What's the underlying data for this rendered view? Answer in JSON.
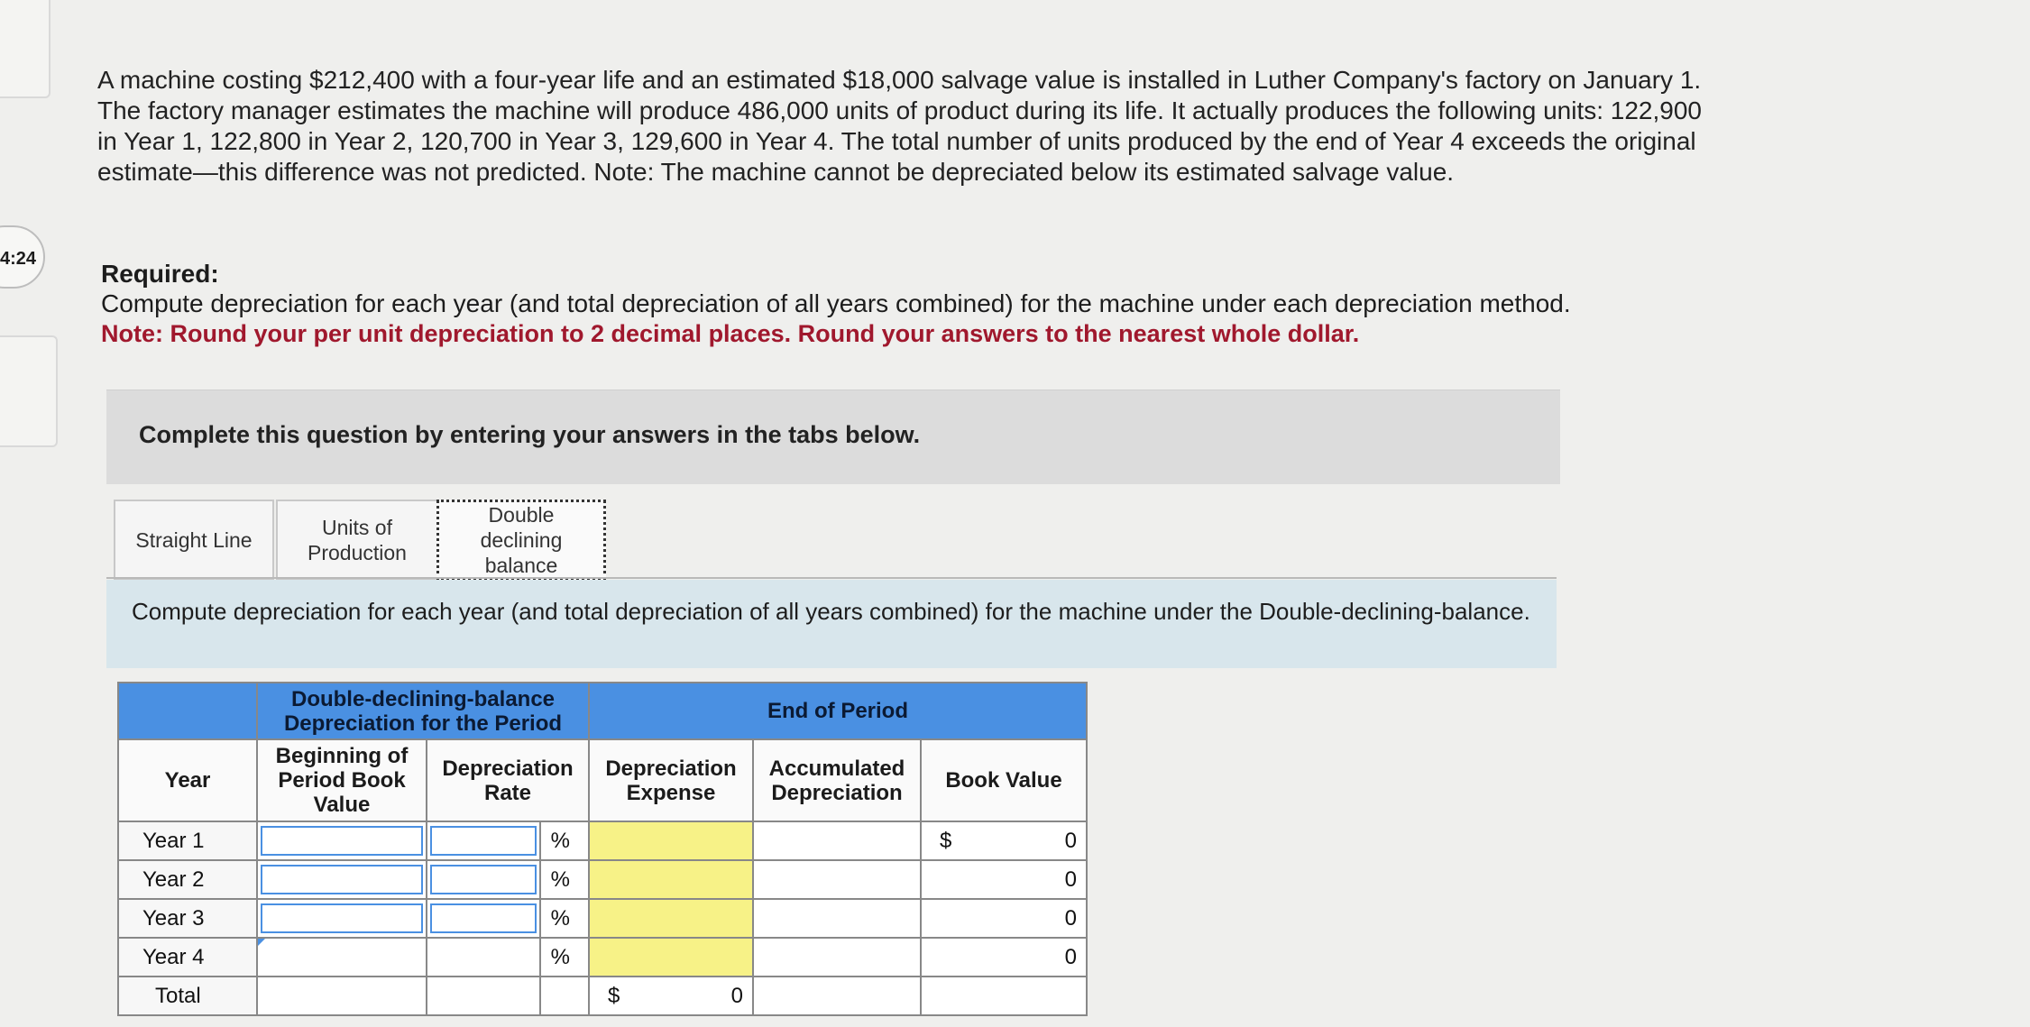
{
  "timer": "4:24",
  "problem": {
    "text": "A machine costing $212,400 with a four-year life and an estimated $18,000 salvage value is installed in Luther Company's factory on January 1. The factory manager estimates the machine will produce 486,000 units of product during its life. It actually produces the following units: 122,900 in Year 1, 122,800 in Year 2, 120,700 in Year 3, 129,600 in Year 4. The total number of units produced by the end of Year 4 exceeds the original estimate—this difference was not predicted. Note: The machine cannot be depreciated below its estimated salvage value.",
    "required_title": "Required:",
    "required_text": "Compute depreciation for each year (and total depreciation of all years combined) for the machine under each depreciation method.",
    "required_note": "Note: Round your per unit depreciation to 2 decimal places. Round your answers to the nearest whole dollar."
  },
  "banner": "Complete this question by entering your answers in the tabs below.",
  "tabs": {
    "straight_line": "Straight Line",
    "units_of_production": "Units of Production",
    "double_declining": "Double declining balance"
  },
  "instruction": "Compute depreciation for each year (and total depreciation of all years combined) for the machine under the Double-declining-balance.",
  "table": {
    "group_header": "Double-declining-balance Depreciation for the Period",
    "end_header": "End of Period",
    "col_year": "Year",
    "col_begin": "Beginning of Period Book Value",
    "col_rate": "Depreciation Rate",
    "col_expense": "Depreciation Expense",
    "col_accum": "Accumulated Depreciation",
    "col_book": "Book Value",
    "pct_symbol": "%",
    "dollar": "$",
    "rows": [
      {
        "label": "Year 1",
        "book_value": "0"
      },
      {
        "label": "Year 2",
        "book_value": "0"
      },
      {
        "label": "Year 3",
        "book_value": "0"
      },
      {
        "label": "Year 4",
        "book_value": "0"
      }
    ],
    "total_label": "Total",
    "total_expense": "0"
  }
}
